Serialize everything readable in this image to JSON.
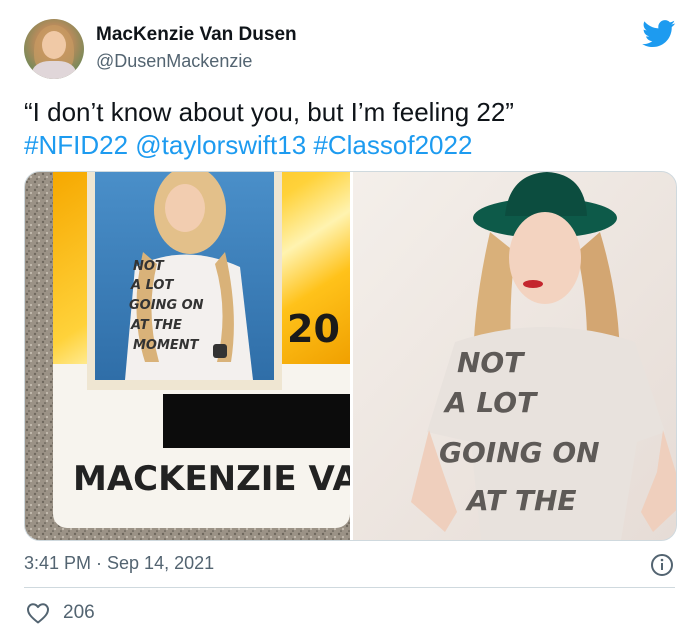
{
  "author": {
    "name": "MacKenzie Van Dusen",
    "handle": "@DusenMackenzie"
  },
  "tweet": {
    "quote": "“I don’t know about you, but I’m feeling 22”",
    "hashtag1": "#NFID22",
    "mention": "@taylorswift13",
    "hashtag2": "#Classof2022"
  },
  "media": {
    "id_card_shirt_lines": [
      "NOT",
      "A LOT",
      "GOING ON",
      "AT THE",
      "MOMENT"
    ],
    "id_card_year": "20",
    "id_card_name": "MACKENZIE VA",
    "photo_shirt_lines": [
      "NOT",
      "A LOT",
      "GOING ON",
      "AT THE"
    ]
  },
  "footer": {
    "timestamp": "3:41 PM · Sep 14, 2021",
    "like_count": "206"
  },
  "icons": {
    "brand": "twitter-bird-icon",
    "info": "info-icon",
    "like": "heart-icon"
  },
  "colors": {
    "link": "#1d9bf0",
    "secondary_text": "#536471",
    "divider": "#cfd9de"
  }
}
